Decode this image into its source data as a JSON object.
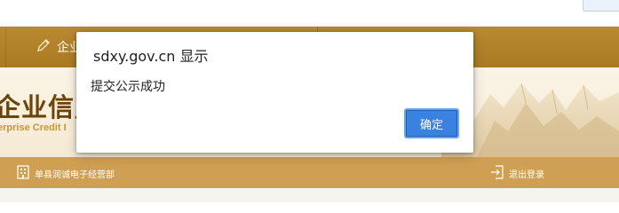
{
  "nav": {
    "item_label": "企业"
  },
  "banner": {
    "title": "企业信用",
    "subtitle": "erprise Credit I"
  },
  "sub_bar": {
    "left_label": "单县润诚电子经营部",
    "right_label": "退出登录"
  },
  "dialog": {
    "title": "sdxy.gov.cn 显示",
    "message": "提交公示成功",
    "ok_label": "确定"
  },
  "colors": {
    "nav_gold": "#b1822a",
    "sub_bar_gold": "#cf9f53",
    "title_brown": "#6b4509",
    "button_blue": "#3b82e0"
  }
}
